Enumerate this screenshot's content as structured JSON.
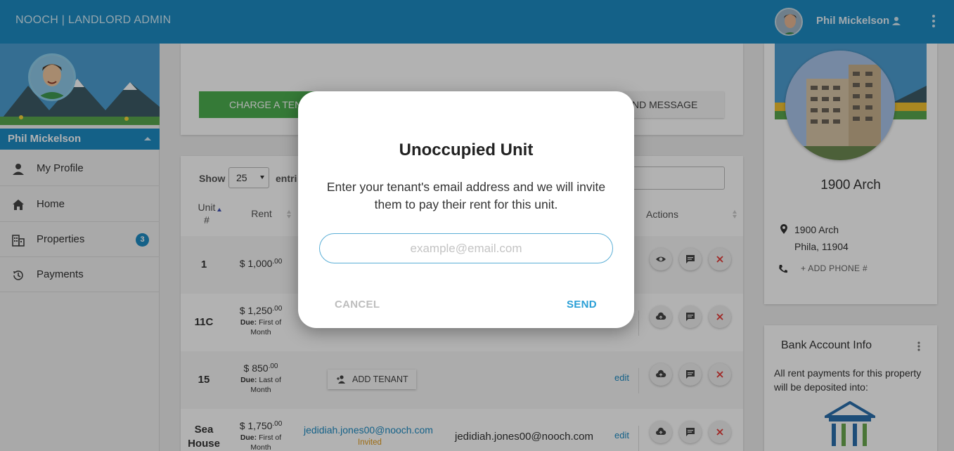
{
  "header": {
    "brand": "NOOCH | LANDLORD ADMIN",
    "user_name": "Phil Mickelson"
  },
  "sidebar": {
    "user_name": "Phil Mickelson",
    "items": [
      {
        "label": "My Profile",
        "icon": "person-icon"
      },
      {
        "label": "Home",
        "icon": "home-icon"
      },
      {
        "label": "Properties",
        "icon": "building-icon",
        "badge": "3"
      },
      {
        "label": "Payments",
        "icon": "history-icon"
      }
    ]
  },
  "main": {
    "charge_label": "CHARGE A TEN",
    "message_label": "ND MESSAGE",
    "table": {
      "show_label": "Show",
      "page_size": "25",
      "entries_label": "entri",
      "headers": {
        "unit": "Unit #",
        "rent": "Rent",
        "actions": "Actions"
      },
      "rows": [
        {
          "unit": "1",
          "rent": "$ 1,000",
          "cents": ".00",
          "due_label": "",
          "due_value": ""
        },
        {
          "unit": "11C",
          "rent": "$ 1,250",
          "cents": ".00",
          "due_label": "Due:",
          "due_value": "First of Month"
        },
        {
          "unit": "15",
          "rent": "$ 850",
          "cents": ".00",
          "due_label": "Due:",
          "due_value": "Last of Month",
          "add_tenant": "ADD TENANT",
          "edit": "edit"
        },
        {
          "unit": "Sea House",
          "rent": "$ 1,750",
          "cents": ".00",
          "due_label": "Due:",
          "due_value": "First of Month",
          "tenant_link": "jedidiah.jones00@nooch.com",
          "status": "Invited",
          "email": "jedidiah.jones00@nooch.com",
          "edit": "edit"
        }
      ]
    }
  },
  "property": {
    "name": "1900 Arch",
    "address_line1": "1900 Arch",
    "address_line2": "Phila, 11904",
    "add_phone": "+ ADD PHONE #"
  },
  "bank": {
    "title": "Bank Account Info",
    "text": "All rent payments for this property will be deposited into:"
  },
  "modal": {
    "title": "Unoccupied Unit",
    "text": "Enter your tenant's email address and we will invite them to pay their rent for this unit.",
    "input_value": "",
    "placeholder": "example@email.com",
    "cancel": "CANCEL",
    "send": "SEND"
  },
  "colors": {
    "brand_blue": "#1e8bc3",
    "charge_green": "#4caf50",
    "tile_purple": "#9c27b0",
    "invited_orange": "#e09a1a"
  }
}
